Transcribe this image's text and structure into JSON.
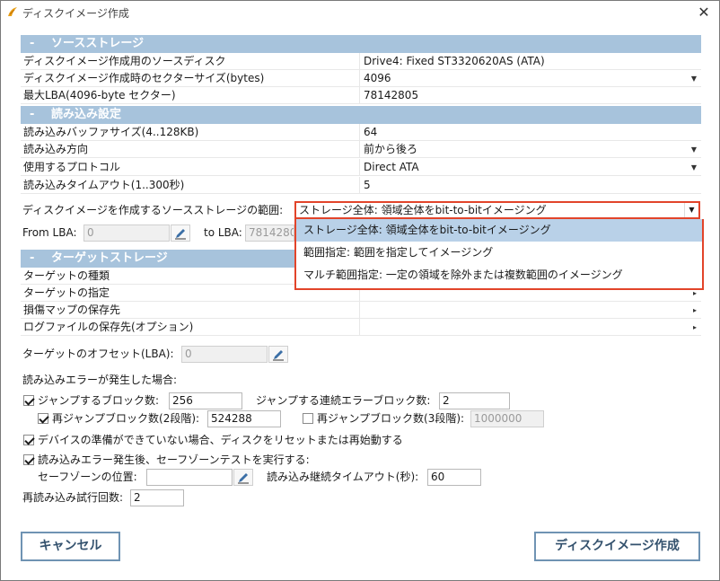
{
  "window": {
    "title": "ディスクイメージ作成",
    "close_label": "✕"
  },
  "source_section": {
    "header": "ソースストレージ",
    "rows": [
      {
        "name": "ディスクイメージ作成用のソースディスク",
        "value": "Drive4: Fixed ST3320620AS (ATA)",
        "arrow": ""
      },
      {
        "name": "ディスクイメージ作成時のセクターサイズ(bytes)",
        "value": "4096",
        "arrow": "▼"
      },
      {
        "name": "最大LBA(4096-byte セクター)",
        "value": "78142805",
        "arrow": ""
      }
    ]
  },
  "read_section": {
    "header": "読み込み設定",
    "rows": [
      {
        "name": "読み込みバッファサイズ(4..128KB)",
        "value": "64",
        "arrow": ""
      },
      {
        "name": "読み込み方向",
        "value": "前から後ろ",
        "arrow": "▼"
      },
      {
        "name": "使用するプロトコル",
        "value": "Direct ATA",
        "arrow": "▼"
      },
      {
        "name": "読み込みタイムアウト(1..300秒)",
        "value": "5",
        "arrow": ""
      }
    ]
  },
  "range": {
    "label": "ディスクイメージを作成するソースストレージの範囲:",
    "selected": "ストレージ全体: 領域全体をbit-to-bitイメージング",
    "options": [
      "ストレージ全体: 領域全体をbit-to-bitイメージング",
      "範囲指定: 範囲を指定してイメージング",
      "マルチ範囲指定: 一定の領域を除外または複数範囲のイメージング"
    ],
    "from_label": "From LBA:",
    "from_value": "0",
    "to_label": "to LBA:",
    "to_value": "7814280"
  },
  "target_section": {
    "header": "ターゲットストレージ",
    "rows": [
      {
        "name": "ターゲットの種類",
        "value": "",
        "arrow": ""
      },
      {
        "name": "ターゲットの指定",
        "value": "",
        "arrow": "▸"
      },
      {
        "name": "損傷マップの保存先",
        "value": "",
        "arrow": "▸"
      },
      {
        "name": "ログファイルの保存先(オプション)",
        "value": "",
        "arrow": "▸"
      }
    ]
  },
  "target_offset": {
    "label": "ターゲットのオフセット(LBA):",
    "value": "0"
  },
  "error_handling": {
    "title": "読み込みエラーが発生した場合:",
    "jump_blocks_label": "ジャンプするブロック数:",
    "jump_blocks_value": "256",
    "jump_blocks_checked": true,
    "consecutive_label": "ジャンプする連続エラーブロック数:",
    "consecutive_value": "2",
    "rejump2_label": "再ジャンプブロック数(2段階):",
    "rejump2_value": "524288",
    "rejump2_checked": true,
    "rejump3_label": "再ジャンプブロック数(3段階):",
    "rejump3_value": "1000000",
    "rejump3_checked": false,
    "reset_label": "デバイスの準備ができていない場合、ディスクをリセットまたは再始動する",
    "reset_checked": true,
    "safezone_label": "読み込みエラー発生後、セーフゾーンテストを実行する:",
    "safezone_checked": true,
    "safezone_pos_label": "セーフゾーンの位置:",
    "safezone_pos_value": "",
    "continue_timeout_label": "読み込み継続タイムアウト(秒):",
    "continue_timeout_value": "60",
    "retry_label": "再読み込み試行回数:",
    "retry_value": "2"
  },
  "buttons": {
    "cancel": "キャンセル",
    "create": "ディスクイメージ作成"
  },
  "colors": {
    "section_header": "#a7c3dc",
    "highlight_border": "#e2442a",
    "selected_option": "#b9d1e8",
    "button_border": "#6f93b3"
  }
}
